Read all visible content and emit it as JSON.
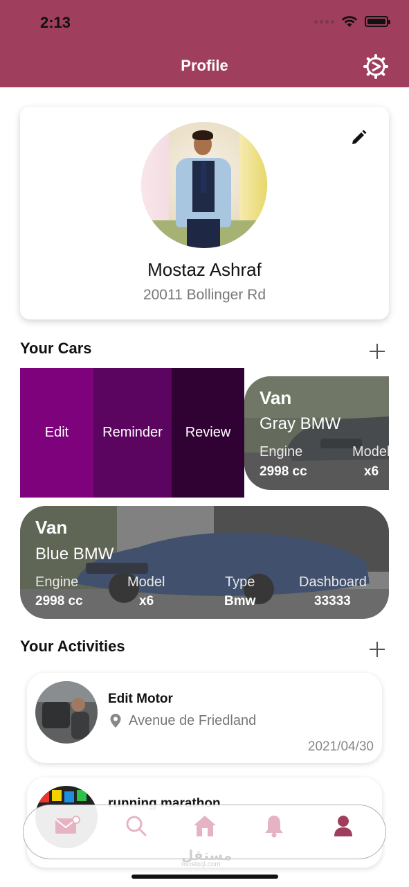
{
  "status_bar": {
    "time": "2:13"
  },
  "header": {
    "title": "Profile"
  },
  "profile": {
    "name": "Mostaz Ashraf",
    "address": "20011 Bollinger Rd"
  },
  "cars_section": {
    "title": "Your Cars"
  },
  "swipe_actions": {
    "edit": "Edit",
    "reminder": "Reminder",
    "review": "Review"
  },
  "cars": [
    {
      "type": "Van",
      "name": "Gray BMW",
      "specs": [
        {
          "label": "Engine",
          "value": "2998 cc"
        },
        {
          "label": "Model",
          "value": "x6"
        }
      ]
    },
    {
      "type": "Van",
      "name": "Blue BMW",
      "specs": [
        {
          "label": "Engine",
          "value": "2998 cc"
        },
        {
          "label": "Model",
          "value": "x6"
        },
        {
          "label": "Type",
          "value": "Bmw"
        },
        {
          "label": "Dashboard",
          "value": "33333"
        }
      ]
    }
  ],
  "activities_section": {
    "title": "Your Activities"
  },
  "activities": [
    {
      "title": "Edit Motor",
      "location": "Avenue de Friedland",
      "date": "2021/04/30"
    },
    {
      "title": "running marathon"
    }
  ],
  "watermark": {
    "text": "مستقل",
    "sub": "mostaql.com"
  },
  "colors": {
    "header": "#a03e5e",
    "edit_action": "#7d027c",
    "reminder_action": "#5b0560",
    "review_action": "#300234",
    "nav_inactive": "#e6b3c3",
    "nav_active": "#a03e5e"
  }
}
